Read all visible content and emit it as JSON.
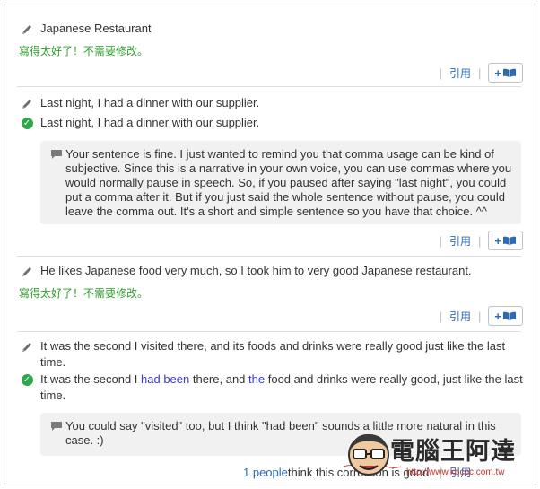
{
  "entries": [
    {
      "original": "Japanese Restaurant",
      "perfect_label": "寫得太好了！不需要修改。",
      "actions": {
        "quote_label": "引用",
        "add_label": "+"
      }
    },
    {
      "original": "Last night, I had a dinner with our supplier.",
      "corrected": "Last night, I had a dinner with our supplier.",
      "comment": "Your sentence is fine. I just wanted to remind you that comma usage can be kind of subjective. Since this is a narrative in your own voice, you can use commas where you would normally pause in speech. So, if you paused after saying \"last night\", you could put a comma after it. But if you just said the whole sentence without pause, you could leave the comma out. It's a short and simple sentence so you have that choice. ^^",
      "actions": {
        "quote_label": "引用",
        "add_label": "+"
      }
    },
    {
      "original": "He likes Japanese food very much, so I took him to very good Japanese restaurant.",
      "perfect_label": "寫得太好了！不需要修改。",
      "actions": {
        "quote_label": "引用",
        "add_label": "+"
      }
    },
    {
      "original": "It was the second I visited there, and its foods and drinks were really good just like the last time.",
      "corrected_parts": [
        "It was the second I ",
        "had been",
        " there, and ",
        "the",
        " food and drinks were really good, just like the last time."
      ],
      "comment": "You could say \"visited\" too, but I think \"had been\" sounds a little more natural in this case. :)",
      "footer": {
        "people_count": "1 people",
        "people_text": " think this correction is good.",
        "quote_label": "引用"
      }
    }
  ],
  "watermark": {
    "text": "電腦王阿達",
    "url": "http://www.kocpc.com.tw"
  },
  "colors": {
    "link": "#2a6bb3",
    "ok": "#2e9c2e",
    "insert": "#3a3ad0",
    "check": "#2ea64c"
  },
  "icons": {
    "original": "pencil-icon",
    "corrected": "check-circle-icon",
    "comment": "speech-bubble-icon",
    "add": "book-icon"
  }
}
